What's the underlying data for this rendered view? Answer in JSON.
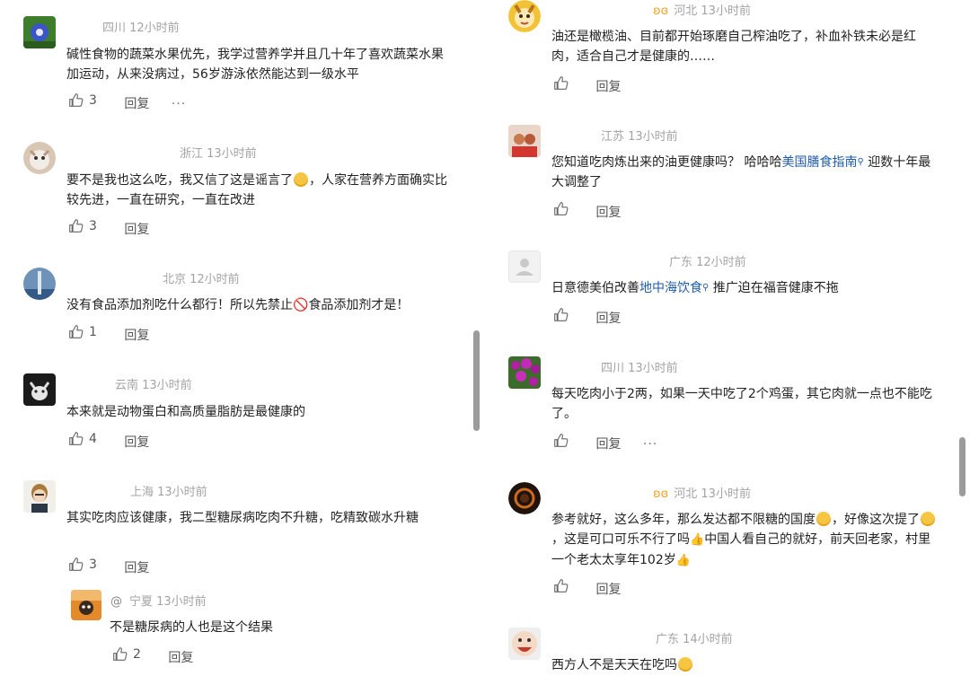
{
  "icons": {
    "like": "thumbs-up-icon",
    "more": "more-dots-icon",
    "badge": "butterfly-badge-icon",
    "search_link": "search-lens-icon",
    "emoji": "laughing-emoji-icon",
    "prohibited": "prohibited-icon",
    "thumbs_emoji": "thumbs-up-emoji-icon"
  },
  "colors": {
    "link": "#1f5cad",
    "badge": "#f0a020",
    "meta": "#a3a3a3",
    "text": "#222222"
  },
  "left_comments": [
    {
      "location_time": "四川 12小时前",
      "text_parts": [
        "碱性食物的蔬菜水果优先，我学过营养学并且几十年了喜欢蔬菜水果加运动，从来没病过，56岁游泳依然能达到一级水平"
      ],
      "likes": "3",
      "reply_label": "回复",
      "more": "···"
    },
    {
      "location_time": "浙江 13小时前",
      "text_parts": [
        "要不是我也这么吃，我又信了这是谣言了",
        "，人家在营养方面确实比较先进，一直在研究，一直在改进"
      ],
      "likes": "3",
      "reply_label": "回复"
    },
    {
      "location_time": "北京 12小时前",
      "text_parts": [
        "没有食品添加剂吃什么都行！所以先禁止",
        "🚫",
        "食品添加剂才是！"
      ],
      "likes": "1",
      "reply_label": "回复"
    },
    {
      "location_time": "云南 13小时前",
      "text_parts": [
        "本来就是动物蛋白和高质量脂肪是最健康的"
      ],
      "likes": "4",
      "reply_label": "回复"
    },
    {
      "location_time": "上海 13小时前",
      "text_parts": [
        "其实吃肉应该健康，我二型糖尿病吃肉不升糖，吃精致碳水升糖"
      ],
      "likes": "3",
      "reply_label": "回复"
    }
  ],
  "left_reply": {
    "at": "@",
    "location_time": "宁夏 13小时前",
    "text": "不是糖尿病的人也是这个结果",
    "likes": "2",
    "reply_label": "回复"
  },
  "right_comments": [
    {
      "location_time": "河北 13小时前",
      "text_parts": [
        "油还是橄榄油、目前都开始琢磨自己榨油吃了，补血补铁未必是红肉，适合自己才是健康的……"
      ],
      "reply_label": "回复"
    },
    {
      "location_time": "江苏 13小时前",
      "text_parts": [
        "您知道吃肉炼出来的油更健康吗？ 哈哈哈",
        "美国膳食指南",
        "迎数十年最大调整了"
      ],
      "reply_label": "回复"
    },
    {
      "location_time": "广东 12小时前",
      "text_parts": [
        "日意德美伯改善",
        "地中海饮食",
        "推广迫在福音健康不拖"
      ],
      "reply_label": "回复"
    },
    {
      "location_time": "四川 13小时前",
      "text_parts": [
        "每天吃肉小于2两，如果一天中吃了2个鸡蛋，其它肉就一点也不能吃了。"
      ],
      "reply_label": "回复",
      "more": "···"
    },
    {
      "location_time": "河北 13小时前",
      "text_parts": [
        "参考就好，这么多年，那么发达都不限糖的国度",
        "，好像这次提了",
        "，这是可口可乐不行了吗",
        "中国人看自己的就好，前天回老家，村里一个老太太享年102岁"
      ],
      "reply_label": "回复"
    },
    {
      "location_time": "广东 14小时前",
      "text_parts": [
        "西方人不是天天在吃吗"
      ]
    }
  ]
}
